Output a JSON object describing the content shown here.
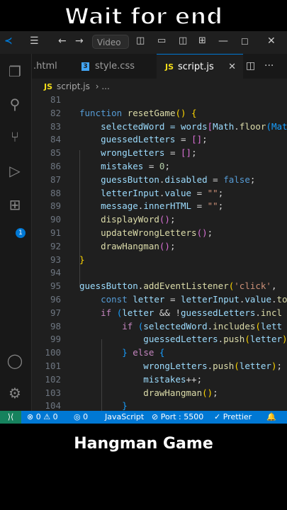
{
  "captions": {
    "top": "Wait for end",
    "bottom": "Hangman Game"
  },
  "titlebar": {
    "search_text": "Video"
  },
  "tabs": [
    {
      "label": ".html",
      "active": false
    },
    {
      "label": "style.css",
      "active": false
    },
    {
      "label": "script.js",
      "active": true
    }
  ],
  "breadcrumb": {
    "file": "script.js",
    "more": "..."
  },
  "activity": {
    "extensions_badge": "1"
  },
  "code_lines": [
    {
      "n": "81",
      "tokens": [
        {
          "t": "",
          "c": "code"
        }
      ]
    },
    {
      "n": "82",
      "tokens": [
        {
          "t": "function ",
          "c": "kw"
        },
        {
          "t": "resetGame",
          "c": "fn"
        },
        {
          "t": "() ",
          "c": "p1"
        },
        {
          "t": "{",
          "c": "p1"
        }
      ]
    },
    {
      "n": "83",
      "tokens": [
        {
          "t": "    selectedWord = ",
          "c": "var"
        },
        {
          "t": "words",
          "c": "var"
        },
        {
          "t": "[",
          "c": "p2"
        },
        {
          "t": "Math",
          "c": "var"
        },
        {
          "t": ".",
          "c": "code"
        },
        {
          "t": "floor",
          "c": "fn"
        },
        {
          "t": "(Math",
          "c": "p3"
        }
      ]
    },
    {
      "n": "84",
      "tokens": [
        {
          "t": "    guessedLetters ",
          "c": "var"
        },
        {
          "t": "= ",
          "c": "code"
        },
        {
          "t": "[]",
          "c": "p2"
        },
        {
          "t": ";",
          "c": "code"
        }
      ]
    },
    {
      "n": "85",
      "tokens": [
        {
          "t": "    wrongLetters ",
          "c": "var"
        },
        {
          "t": "= ",
          "c": "code"
        },
        {
          "t": "[]",
          "c": "p2"
        },
        {
          "t": ";",
          "c": "code"
        }
      ]
    },
    {
      "n": "86",
      "tokens": [
        {
          "t": "    mistakes ",
          "c": "var"
        },
        {
          "t": "= ",
          "c": "code"
        },
        {
          "t": "0",
          "c": "num"
        },
        {
          "t": ";",
          "c": "code"
        }
      ]
    },
    {
      "n": "87",
      "tokens": [
        {
          "t": "    guessButton",
          "c": "var"
        },
        {
          "t": ".",
          "c": "code"
        },
        {
          "t": "disabled ",
          "c": "var"
        },
        {
          "t": "= ",
          "c": "code"
        },
        {
          "t": "false",
          "c": "kw"
        },
        {
          "t": ";",
          "c": "code"
        }
      ]
    },
    {
      "n": "88",
      "tokens": [
        {
          "t": "    letterInput",
          "c": "var"
        },
        {
          "t": ".",
          "c": "code"
        },
        {
          "t": "value ",
          "c": "var"
        },
        {
          "t": "= ",
          "c": "code"
        },
        {
          "t": "\"\"",
          "c": "str"
        },
        {
          "t": ";",
          "c": "code"
        }
      ]
    },
    {
      "n": "89",
      "tokens": [
        {
          "t": "    message",
          "c": "var"
        },
        {
          "t": ".",
          "c": "code"
        },
        {
          "t": "innerHTML ",
          "c": "var"
        },
        {
          "t": "= ",
          "c": "code"
        },
        {
          "t": "\"\"",
          "c": "str"
        },
        {
          "t": ";",
          "c": "code"
        }
      ]
    },
    {
      "n": "90",
      "tokens": [
        {
          "t": "    displayWord",
          "c": "fn"
        },
        {
          "t": "()",
          "c": "p2"
        },
        {
          "t": ";",
          "c": "code"
        }
      ]
    },
    {
      "n": "91",
      "tokens": [
        {
          "t": "    updateWrongLetters",
          "c": "fn"
        },
        {
          "t": "()",
          "c": "p2"
        },
        {
          "t": ";",
          "c": "code"
        }
      ]
    },
    {
      "n": "92",
      "tokens": [
        {
          "t": "    drawHangman",
          "c": "fn"
        },
        {
          "t": "()",
          "c": "p2"
        },
        {
          "t": ";",
          "c": "code"
        }
      ]
    },
    {
      "n": "93",
      "tokens": [
        {
          "t": "}",
          "c": "p1"
        }
      ]
    },
    {
      "n": "94",
      "tokens": [
        {
          "t": "",
          "c": "code"
        }
      ]
    },
    {
      "n": "95",
      "tokens": [
        {
          "t": "guessButton",
          "c": "var"
        },
        {
          "t": ".",
          "c": "code"
        },
        {
          "t": "addEventListener",
          "c": "fn"
        },
        {
          "t": "(",
          "c": "p1"
        },
        {
          "t": "'click'",
          "c": "str"
        },
        {
          "t": ", ",
          "c": "code"
        }
      ]
    },
    {
      "n": "96",
      "tokens": [
        {
          "t": "    const ",
          "c": "kw"
        },
        {
          "t": "letter ",
          "c": "var"
        },
        {
          "t": "= ",
          "c": "code"
        },
        {
          "t": "letterInput",
          "c": "var"
        },
        {
          "t": ".",
          "c": "code"
        },
        {
          "t": "value",
          "c": "var"
        },
        {
          "t": ".",
          "c": "code"
        },
        {
          "t": "to",
          "c": "fn"
        }
      ]
    },
    {
      "n": "97",
      "tokens": [
        {
          "t": "    if ",
          "c": "ctrl"
        },
        {
          "t": "(",
          "c": "p3"
        },
        {
          "t": "letter ",
          "c": "var"
        },
        {
          "t": "&& !",
          "c": "code"
        },
        {
          "t": "guessedLetters",
          "c": "var"
        },
        {
          "t": ".",
          "c": "code"
        },
        {
          "t": "incl",
          "c": "fn"
        }
      ]
    },
    {
      "n": "98",
      "tokens": [
        {
          "t": "        if ",
          "c": "ctrl"
        },
        {
          "t": "(",
          "c": "p3"
        },
        {
          "t": "selectedWord",
          "c": "var"
        },
        {
          "t": ".",
          "c": "code"
        },
        {
          "t": "includes",
          "c": "fn"
        },
        {
          "t": "(",
          "c": "p1"
        },
        {
          "t": "lett",
          "c": "var"
        }
      ]
    },
    {
      "n": "99",
      "tokens": [
        {
          "t": "            guessedLetters",
          "c": "var"
        },
        {
          "t": ".",
          "c": "code"
        },
        {
          "t": "push",
          "c": "fn"
        },
        {
          "t": "(",
          "c": "p1"
        },
        {
          "t": "letter",
          "c": "var"
        },
        {
          "t": ")",
          "c": "p1"
        }
      ]
    },
    {
      "n": "100",
      "tokens": [
        {
          "t": "        ",
          "c": "code"
        },
        {
          "t": "} ",
          "c": "p3"
        },
        {
          "t": "else ",
          "c": "ctrl"
        },
        {
          "t": "{",
          "c": "p3"
        }
      ]
    },
    {
      "n": "101",
      "tokens": [
        {
          "t": "            wrongLetters",
          "c": "var"
        },
        {
          "t": ".",
          "c": "code"
        },
        {
          "t": "push",
          "c": "fn"
        },
        {
          "t": "(",
          "c": "p1"
        },
        {
          "t": "letter",
          "c": "var"
        },
        {
          "t": ")",
          "c": "p1"
        },
        {
          "t": ";",
          "c": "code"
        }
      ]
    },
    {
      "n": "102",
      "tokens": [
        {
          "t": "            mistakes",
          "c": "var"
        },
        {
          "t": "++;",
          "c": "code"
        }
      ]
    },
    {
      "n": "103",
      "tokens": [
        {
          "t": "            drawHangman",
          "c": "fn"
        },
        {
          "t": "()",
          "c": "p1"
        },
        {
          "t": ";",
          "c": "code"
        }
      ]
    },
    {
      "n": "104",
      "tokens": [
        {
          "t": "        }",
          "c": "p3"
        }
      ]
    }
  ],
  "statusbar": {
    "errors": "0",
    "warnings": "0",
    "ports": "0",
    "language": "JavaScript",
    "port": "Port : 5500",
    "formatter": "Prettier"
  },
  "colors": {
    "accent": "#0078d4",
    "remote": "#16825d",
    "editor_bg": "#1f1f1f"
  }
}
